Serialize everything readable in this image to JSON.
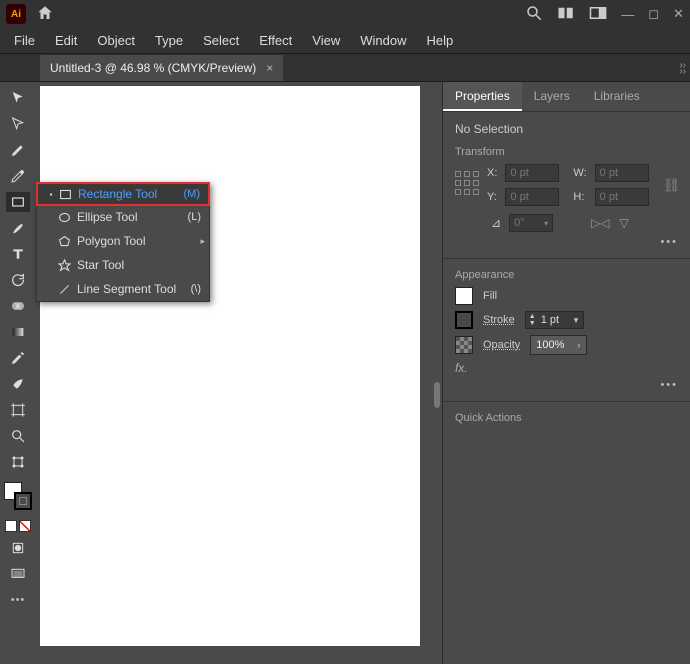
{
  "app": {
    "badge": "Ai"
  },
  "menubar": [
    "File",
    "Edit",
    "Object",
    "Type",
    "Select",
    "Effect",
    "View",
    "Window",
    "Help"
  ],
  "tab": {
    "title": "Untitled-3 @ 46.98 % (CMYK/Preview)",
    "close": "×"
  },
  "flyout": {
    "items": [
      {
        "label": "Rectangle Tool",
        "key": "(M)",
        "active": true
      },
      {
        "label": "Ellipse Tool",
        "key": "(L)"
      },
      {
        "label": "Polygon Tool",
        "key": "",
        "submenu": true
      },
      {
        "label": "Star Tool",
        "key": ""
      },
      {
        "label": "Line Segment Tool",
        "key": "(\\)"
      }
    ]
  },
  "panels": {
    "tabs": {
      "properties": "Properties",
      "layers": "Layers",
      "libraries": "Libraries"
    },
    "noSelection": "No Selection",
    "transform": {
      "title": "Transform",
      "xLabel": "X:",
      "yLabel": "Y:",
      "wLabel": "W:",
      "hLabel": "H:",
      "x": "0 pt",
      "y": "0 pt",
      "w": "0 pt",
      "h": "0 pt",
      "angleLabel": "⊿",
      "angle": "0°"
    },
    "appearance": {
      "title": "Appearance",
      "fillLabel": "Fill",
      "strokeLabel": "Stroke",
      "strokeValue": "1 pt",
      "opacityLabel": "Opacity",
      "opacityValue": "100%",
      "fx": "fx."
    },
    "quickActions": "Quick Actions"
  }
}
